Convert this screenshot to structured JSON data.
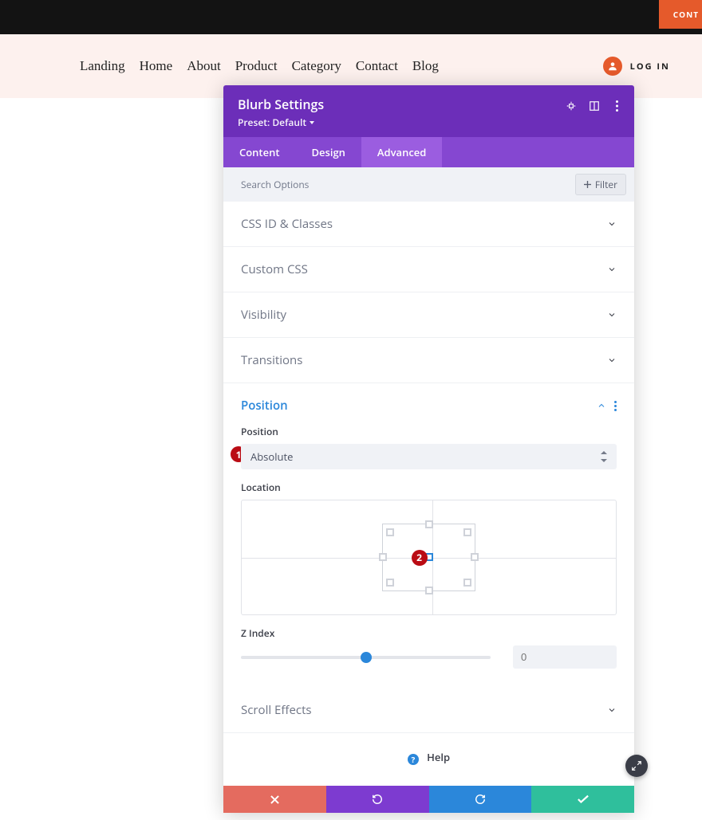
{
  "topbar": {
    "contact": "CONT"
  },
  "nav": {
    "items": [
      "Landing",
      "Home",
      "About",
      "Product",
      "Category",
      "Contact",
      "Blog"
    ],
    "login": "LOG IN"
  },
  "panel": {
    "title": "Blurb Settings",
    "preset": "Preset: Default",
    "tabs": [
      "Content",
      "Design",
      "Advanced"
    ],
    "search_placeholder": "Search Options",
    "filter": "Filter",
    "accordions": [
      "CSS ID & Classes",
      "Custom CSS",
      "Visibility",
      "Transitions"
    ],
    "position": {
      "title": "Position",
      "label_position": "Position",
      "value_position": "Absolute",
      "badge1": "1",
      "label_location": "Location",
      "badge2": "2",
      "label_z": "Z Index",
      "z_value": "0"
    },
    "scroll": "Scroll Effects",
    "help": "Help"
  }
}
